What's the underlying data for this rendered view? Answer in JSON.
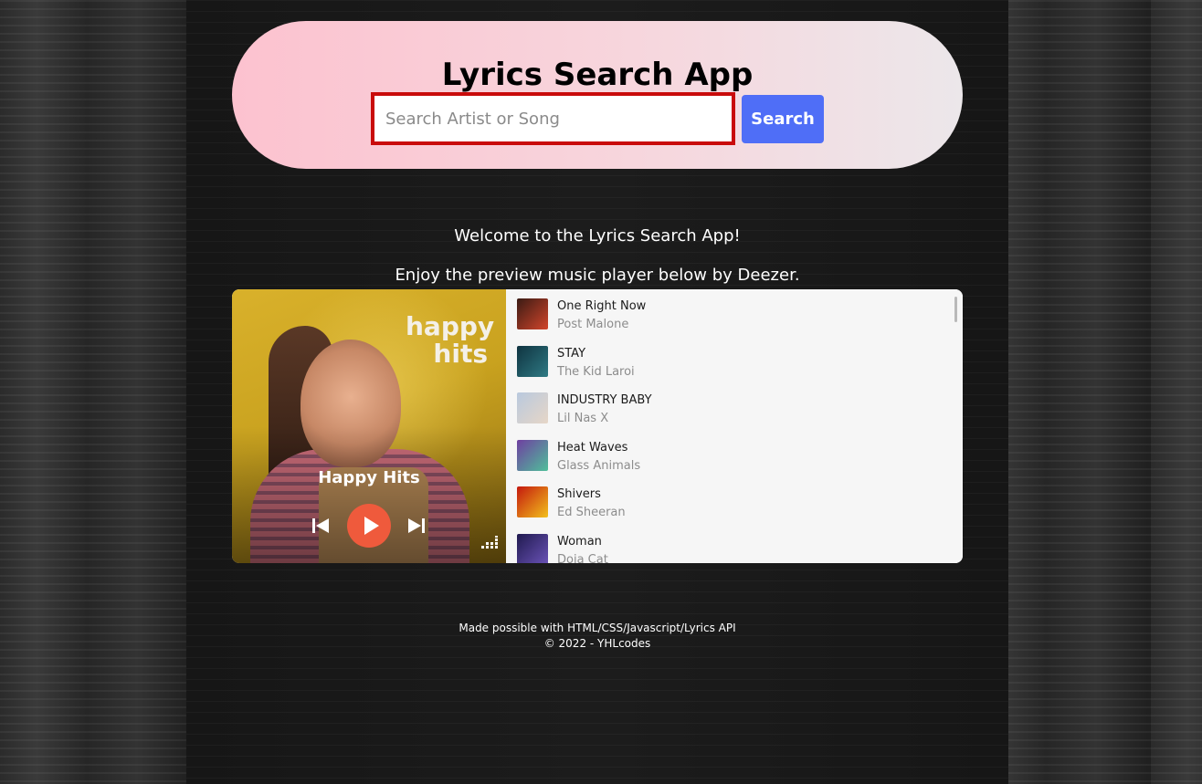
{
  "header": {
    "title": "Lyrics Search App",
    "search_placeholder": "Search Artist or Song",
    "search_value": "",
    "search_button_label": "Search"
  },
  "main": {
    "welcome_text": "Welcome to the Lyrics Search App!",
    "enjoy_text": "Enjoy the preview music player below by Deezer."
  },
  "player": {
    "provider": "Deezer",
    "cover_brand_line1": "happy",
    "cover_brand_line2": "hits",
    "playlist_title": "Happy Hits",
    "controls": [
      "previous-icon",
      "play-icon",
      "next-icon"
    ],
    "accent_color": "#ef5a3c",
    "tracks": [
      {
        "title": "One Right Now",
        "artist": "Post Malone",
        "thumb_colors": [
          "#3a1b14",
          "#d2452b"
        ]
      },
      {
        "title": "STAY",
        "artist": "The Kid Laroi",
        "thumb_colors": [
          "#0f3340",
          "#2f7a84"
        ]
      },
      {
        "title": "INDUSTRY BABY",
        "artist": "Lil Nas X",
        "thumb_colors": [
          "#b9c9de",
          "#e6d6c7"
        ]
      },
      {
        "title": "Heat Waves",
        "artist": "Glass Animals",
        "thumb_colors": [
          "#6f3fa1",
          "#4fbf9a"
        ]
      },
      {
        "title": "Shivers",
        "artist": "Ed Sheeran",
        "thumb_colors": [
          "#c4180e",
          "#f2c01c"
        ]
      },
      {
        "title": "Woman",
        "artist": "Doja Cat",
        "thumb_colors": [
          "#201a4f",
          "#6b53b8"
        ]
      }
    ]
  },
  "footer": {
    "made_with": "Made possible with HTML/CSS/Javascript/Lyrics API",
    "copyright": "© 2022 - YHLcodes"
  },
  "colors": {
    "search_button": "#4f6ef7",
    "search_border": "#c90b0b",
    "hero_gradient_start": "#fcc2cf",
    "hero_gradient_end": "#ece7ea"
  }
}
